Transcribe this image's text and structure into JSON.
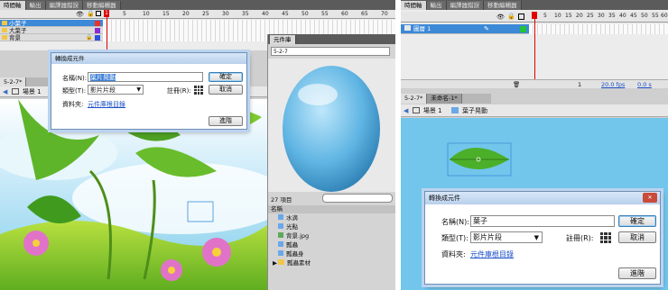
{
  "left": {
    "panel_tabs": [
      "時間軸",
      "輸出",
      "編譯器錯誤",
      "移動編輯器"
    ],
    "timeline": {
      "frame_numbers": [
        "1",
        "5",
        "10",
        "15",
        "20",
        "25",
        "30",
        "35",
        "40",
        "45",
        "50",
        "55",
        "60",
        "65",
        "70"
      ],
      "layers": [
        {
          "name": "小葉子",
          "selected": true
        },
        {
          "name": "大葉子",
          "selected": false
        },
        {
          "name": "背景",
          "selected": false
        }
      ]
    },
    "doc_tab": "5-2-7*",
    "scene_label": "場景 1",
    "dialog": {
      "title": "轉換成元件",
      "name_label": "名稱(N):",
      "name_value": "葉片晃動",
      "type_label": "類型(T):",
      "type_value": "影片片段",
      "registration_label": "註冊(R):",
      "folder_label": "資料夾:",
      "folder_link": "元件庫根目錄",
      "ok_label": "確定",
      "cancel_label": "取消",
      "advanced_label": "進階"
    },
    "library": {
      "tab_label": "元件庫",
      "doc_select": "5-2-7",
      "item_count": "27 項目",
      "column_name": "名稱",
      "items": [
        "水滴",
        "光點",
        "背景.jpg",
        "瓢蟲",
        "瓢蟲身",
        "瓢蟲素材"
      ]
    }
  },
  "right": {
    "panel_tabs": [
      "時間軸",
      "輸出",
      "編譯器錯誤",
      "移動編輯器"
    ],
    "timeline": {
      "frame_numbers": [
        "1",
        "5",
        "10",
        "15",
        "20",
        "25",
        "30",
        "35",
        "40",
        "45",
        "50",
        "55",
        "60"
      ],
      "layers": [
        {
          "name": "圖層 1",
          "selected": true
        }
      ],
      "frame_rate": "20.0 fps",
      "time": "0.0 s",
      "current_frame": "1"
    },
    "doc_tabs": [
      "5-2-7*",
      "未命名-1*"
    ],
    "breadcrumb": [
      "場景 1",
      "葉子晃動"
    ],
    "dialog": {
      "title": "轉換成元件",
      "name_label": "名稱(N):",
      "name_value": "葉子",
      "type_label": "類型(T):",
      "type_value": "影片片段",
      "registration_label": "註冊(R):",
      "folder_label": "資料夾:",
      "folder_link": "元件庫根目錄",
      "ok_label": "確定",
      "cancel_label": "取消",
      "advanced_label": "進階"
    }
  }
}
